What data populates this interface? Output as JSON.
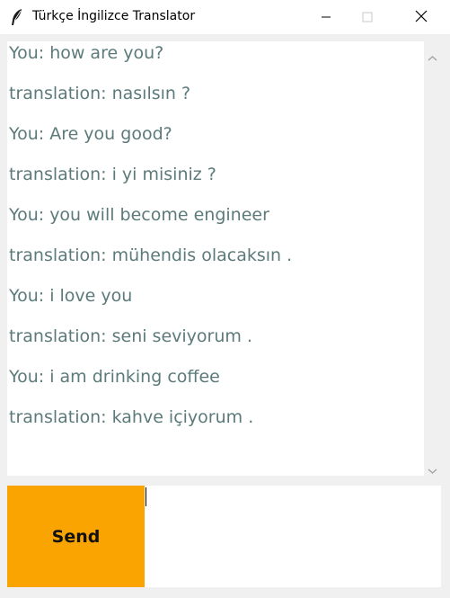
{
  "window": {
    "title": "Türkçe İngilizce Translator",
    "app_icon": "feather-icon",
    "controls": [
      "minimize-icon",
      "maximize-icon",
      "close-icon"
    ]
  },
  "chat": {
    "lines": [
      "You: how are you?",
      "translation: nasılsın ?",
      "You: Are you good?",
      "translation: i yi misiniz ?",
      "You: you will become engineer",
      "translation: mühendis olacaksın .",
      "You: i love you",
      "translation: seni seviyorum .",
      "You: i am drinking coffee",
      "translation: kahve içiyorum ."
    ],
    "text_color": "#5c7a7a"
  },
  "composer": {
    "send_label": "Send",
    "send_color": "#f9a400",
    "input_value": ""
  }
}
